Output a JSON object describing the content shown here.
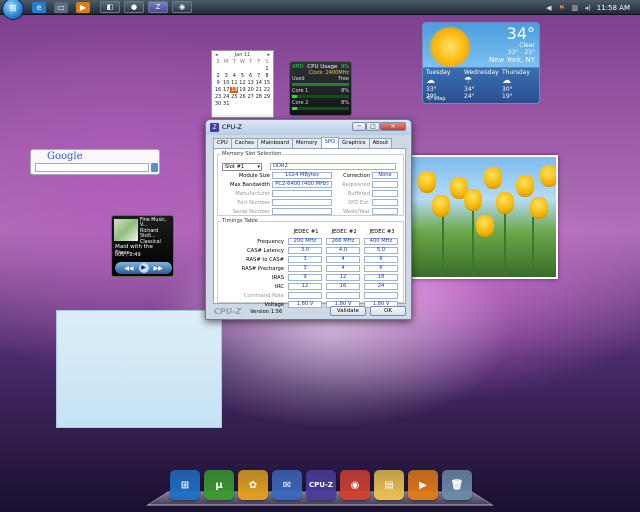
{
  "taskbar": {
    "start_glyph": "⊞",
    "quicklaunch": [
      {
        "name": "ie-icon",
        "glyph": "e",
        "color": "#2a7ad0"
      },
      {
        "name": "show-desktop-icon",
        "glyph": "▭",
        "color": "#5a6a80"
      },
      {
        "name": "media-icon",
        "glyph": "▶",
        "color": "#e07a18"
      }
    ],
    "tasks": [
      {
        "name": "task-gadgets",
        "glyph": "◧",
        "active": false
      },
      {
        "name": "task-chrome",
        "glyph": "●",
        "active": false
      },
      {
        "name": "task-cpuz",
        "glyph": "Z",
        "active": true
      },
      {
        "name": "task-hdd",
        "glyph": "◉",
        "active": false
      }
    ],
    "clock": "11:58 AM"
  },
  "weather": {
    "temp": "34°",
    "condition": "Clear",
    "range": "33° - 23°",
    "location": "New York, NY",
    "forecast": [
      {
        "day": "Tuesday",
        "hi": "33°",
        "lo": "29°"
      },
      {
        "day": "Wednesday",
        "hi": "34°",
        "lo": "24°"
      },
      {
        "day": "Thursday",
        "hi": "30°",
        "lo": "19°"
      }
    ],
    "source": "© iMap"
  },
  "calendar": {
    "month": "Jan 11",
    "dow": [
      "S",
      "M",
      "T",
      "W",
      "T",
      "F",
      "S"
    ],
    "days": [
      "",
      "",
      "",
      "",
      "",
      "",
      "1",
      "2",
      "3",
      "4",
      "5",
      "6",
      "7",
      "8",
      "9",
      "10",
      "11",
      "12",
      "13",
      "14",
      "15",
      "16",
      "17",
      "18",
      "19",
      "20",
      "21",
      "22",
      "23",
      "24",
      "25",
      "26",
      "27",
      "28",
      "29",
      "30",
      "31"
    ],
    "today": "18"
  },
  "cpu_usage": {
    "title": "CPU Usage",
    "percent": "9%",
    "brand": "AMD",
    "clock_label": "Clock: 2400MHz",
    "rows": [
      {
        "label": "Used",
        "value": "Free"
      },
      {
        "label": "Core 1",
        "value": "8%"
      },
      {
        "label": "Core 2",
        "value": "8%"
      }
    ],
    "core_levels": [
      0.08,
      0.08
    ]
  },
  "google": {
    "logo": "Google"
  },
  "media": {
    "info_lines": [
      "Fine Music, V...",
      "Richard Stolt...",
      "Classical"
    ],
    "track": "Maid with the Flaxe...",
    "time": "000 / 2:49",
    "controls": {
      "prev": "◀◀",
      "play": "▶",
      "next": "▶▶"
    }
  },
  "cpuz": {
    "title": "CPU-Z",
    "tabs": [
      "CPU",
      "Caches",
      "Mainboard",
      "Memory",
      "SPD",
      "Graphics",
      "About"
    ],
    "active_tab": "SPD",
    "memory_slot": {
      "legend": "Memory Slot Selection",
      "slot": "Slot #1",
      "type": "DDR2",
      "module_size_label": "Module Size",
      "module_size": "1024 MBytes",
      "max_bw_label": "Max Bandwidth",
      "max_bw": "PC2-6400 (400 MHz)",
      "manufacturer_label": "Manufacturer",
      "part_label": "Part Number",
      "serial_label": "Serial Number",
      "correction_label": "Correction",
      "correction": "None",
      "registered_label": "Registered",
      "buffered_label": "Buffered",
      "spd_ext_label": "SPD Ext.",
      "week_year_label": "Week/Year"
    },
    "timings": {
      "legend": "Timings Table",
      "columns": [
        "JEDEC #1",
        "JEDEC #2",
        "JEDEC #3"
      ],
      "rows": [
        {
          "label": "Frequency",
          "values": [
            "200 MHz",
            "266 MHz",
            "400 MHz"
          ],
          "grey": false
        },
        {
          "label": "CAS# Latency",
          "values": [
            "3.0",
            "4.0",
            "5.0"
          ],
          "grey": false
        },
        {
          "label": "RAS# to CAS#",
          "values": [
            "3",
            "4",
            "6"
          ],
          "grey": false
        },
        {
          "label": "RAS# Precharge",
          "values": [
            "3",
            "4",
            "6"
          ],
          "grey": false
        },
        {
          "label": "tRAS",
          "values": [
            "9",
            "12",
            "18"
          ],
          "grey": false
        },
        {
          "label": "tRC",
          "values": [
            "12",
            "16",
            "24"
          ],
          "grey": false
        },
        {
          "label": "Command Rate",
          "values": [
            "",
            "",
            ""
          ],
          "grey": true
        },
        {
          "label": "Voltage",
          "values": [
            "1.80 V",
            "1.80 V",
            "1.80 V"
          ],
          "grey": false
        }
      ]
    },
    "footer_logo": "CPU-Z",
    "version": "Version 1.56",
    "validate": "Validate",
    "ok": "OK",
    "controls": {
      "min": "─",
      "max": "□",
      "close": "✕"
    }
  },
  "dock": [
    {
      "name": "windows-dock-icon",
      "glyph": "⊞",
      "color": "#1f6fc4"
    },
    {
      "name": "utorrent-dock-icon",
      "glyph": "µ",
      "color": "#3a9a30"
    },
    {
      "name": "fl-studio-dock-icon",
      "glyph": "✿",
      "color": "#e0a020"
    },
    {
      "name": "thunderbird-dock-icon",
      "glyph": "✉",
      "color": "#3a68b8"
    },
    {
      "name": "cpuz-dock-icon",
      "glyph": "CPU-Z",
      "color": "#4b3c9c"
    },
    {
      "name": "chrome-dock-icon",
      "glyph": "◉",
      "color": "#d04030"
    },
    {
      "name": "explorer-dock-icon",
      "glyph": "▤",
      "color": "#e8c050"
    },
    {
      "name": "media-player-dock-icon",
      "glyph": "▶",
      "color": "#e07a18"
    },
    {
      "name": "recycle-bin-dock-icon",
      "glyph": "🗑",
      "color": "#6a8aa8"
    }
  ]
}
